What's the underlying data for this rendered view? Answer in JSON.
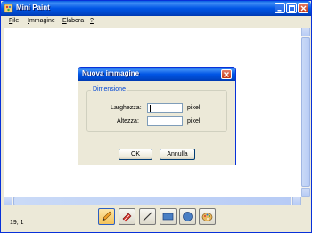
{
  "window": {
    "title": "Mini Paint"
  },
  "menu": [
    {
      "label": "File",
      "u": "F",
      "rest": "ile"
    },
    {
      "label": "Immagine",
      "u": "I",
      "rest": "mmagine"
    },
    {
      "label": "Elabora",
      "u": "E",
      "rest": "labora"
    },
    {
      "label": "?",
      "u": "?",
      "rest": ""
    }
  ],
  "status": {
    "coords": "19; 1"
  },
  "dialog": {
    "title": "Nuova immagine",
    "group_label": "Dimensione",
    "width_label": "Larghezza:",
    "height_label": "Altezza:",
    "width_value": "",
    "height_value": "",
    "unit": "pixel",
    "ok_label": "OK",
    "cancel_label": "Annulla"
  },
  "tools": [
    "pencil-icon",
    "eraser-icon",
    "line-icon",
    "rectangle-icon",
    "circle-icon",
    "palette-icon"
  ],
  "colors": {
    "titlebar": "#0055e5",
    "window_bg": "#ece9d8",
    "accent": "#0046d5"
  }
}
